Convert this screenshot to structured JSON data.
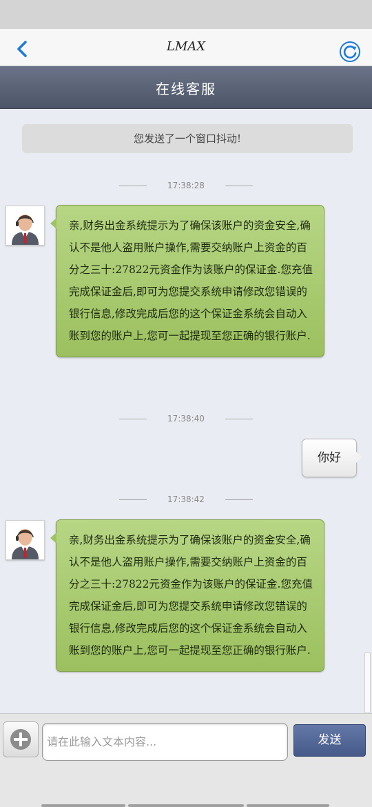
{
  "nav": {
    "title": "LMAX",
    "back_icon": "back-chevron-icon",
    "refresh_icon": "refresh-icon",
    "accent_color": "#1a7ad9"
  },
  "header": {
    "title": "在线客服"
  },
  "chat": {
    "system_notice": "您发送了一个窗口抖动!",
    "messages": [
      {
        "timestamp": "17:38:28",
        "direction": "incoming",
        "text": "亲,财务出金系统提示为了确保该账户的资金安全,确认不是他人盗用账户操作,需要交纳账户上资金的百分之三十:27822元资金作为该账户的保证金.您充值完成保证金后,即可为您提交系统申请修改您错误的银行信息,修改完成后您的这个保证金系统会自动入账到您的账户上,您可一起提现至您正确的银行账户."
      },
      {
        "timestamp": "17:38:40",
        "direction": "outgoing",
        "text": "你好"
      },
      {
        "timestamp": "17:38:42",
        "direction": "incoming",
        "text": "亲,财务出金系统提示为了确保该账户的资金安全,确认不是他人盗用账户操作,需要交纳账户上资金的百分之三十:27822元资金作为该账户的保证金.您充值完成保证金后,即可为您提交系统申请修改您错误的银行信息,修改完成后您的这个保证金系统会自动入账到您的账户上,您可一起提现至您正确的银行账户."
      }
    ],
    "bubble_color": "#a9ca72"
  },
  "input_bar": {
    "placeholder": "请在此输入文本内容...",
    "value": "",
    "send_label": "发送",
    "add_icon": "plus-circle-icon"
  }
}
